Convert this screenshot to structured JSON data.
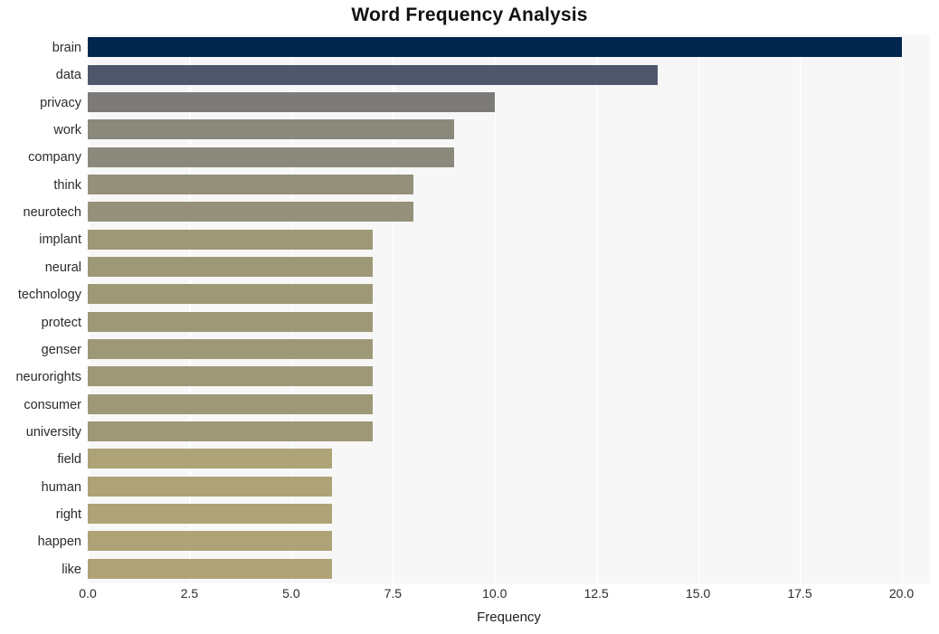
{
  "chart_data": {
    "type": "bar",
    "orientation": "horizontal",
    "title": "Word Frequency Analysis",
    "xlabel": "Frequency",
    "ylabel": "",
    "categories": [
      "brain",
      "data",
      "privacy",
      "work",
      "company",
      "think",
      "neurotech",
      "implant",
      "neural",
      "technology",
      "protect",
      "genser",
      "neurorights",
      "consumer",
      "university",
      "field",
      "human",
      "right",
      "happen",
      "like"
    ],
    "values": [
      20,
      14,
      10,
      9,
      9,
      8,
      8,
      7,
      7,
      7,
      7,
      7,
      7,
      7,
      7,
      6,
      6,
      6,
      6,
      6
    ],
    "bar_colors": [
      "#01264d",
      "#4d566b",
      "#7c7b78",
      "#8b897c",
      "#8b897c",
      "#95907a",
      "#95907a",
      "#9d9876",
      "#9d9876",
      "#9d9876",
      "#9d9876",
      "#9d9876",
      "#9d9876",
      "#9d9876",
      "#9d9876",
      "#ada377",
      "#ada377",
      "#ada377",
      "#ada377",
      "#ada377"
    ],
    "xlim": [
      0.0,
      20.7
    ],
    "xticks": [
      0.0,
      2.5,
      5.0,
      7.5,
      10.0,
      12.5,
      15.0,
      17.5,
      20.0
    ],
    "xtick_labels": [
      "0.0",
      "2.5",
      "5.0",
      "7.5",
      "10.0",
      "12.5",
      "15.0",
      "17.5",
      "20.0"
    ],
    "grid": true,
    "grid_axis": "x",
    "grid_color": "#ffffff",
    "plot_background": "#f7f7f7",
    "figure_background": "#ffffff",
    "legend": null
  }
}
